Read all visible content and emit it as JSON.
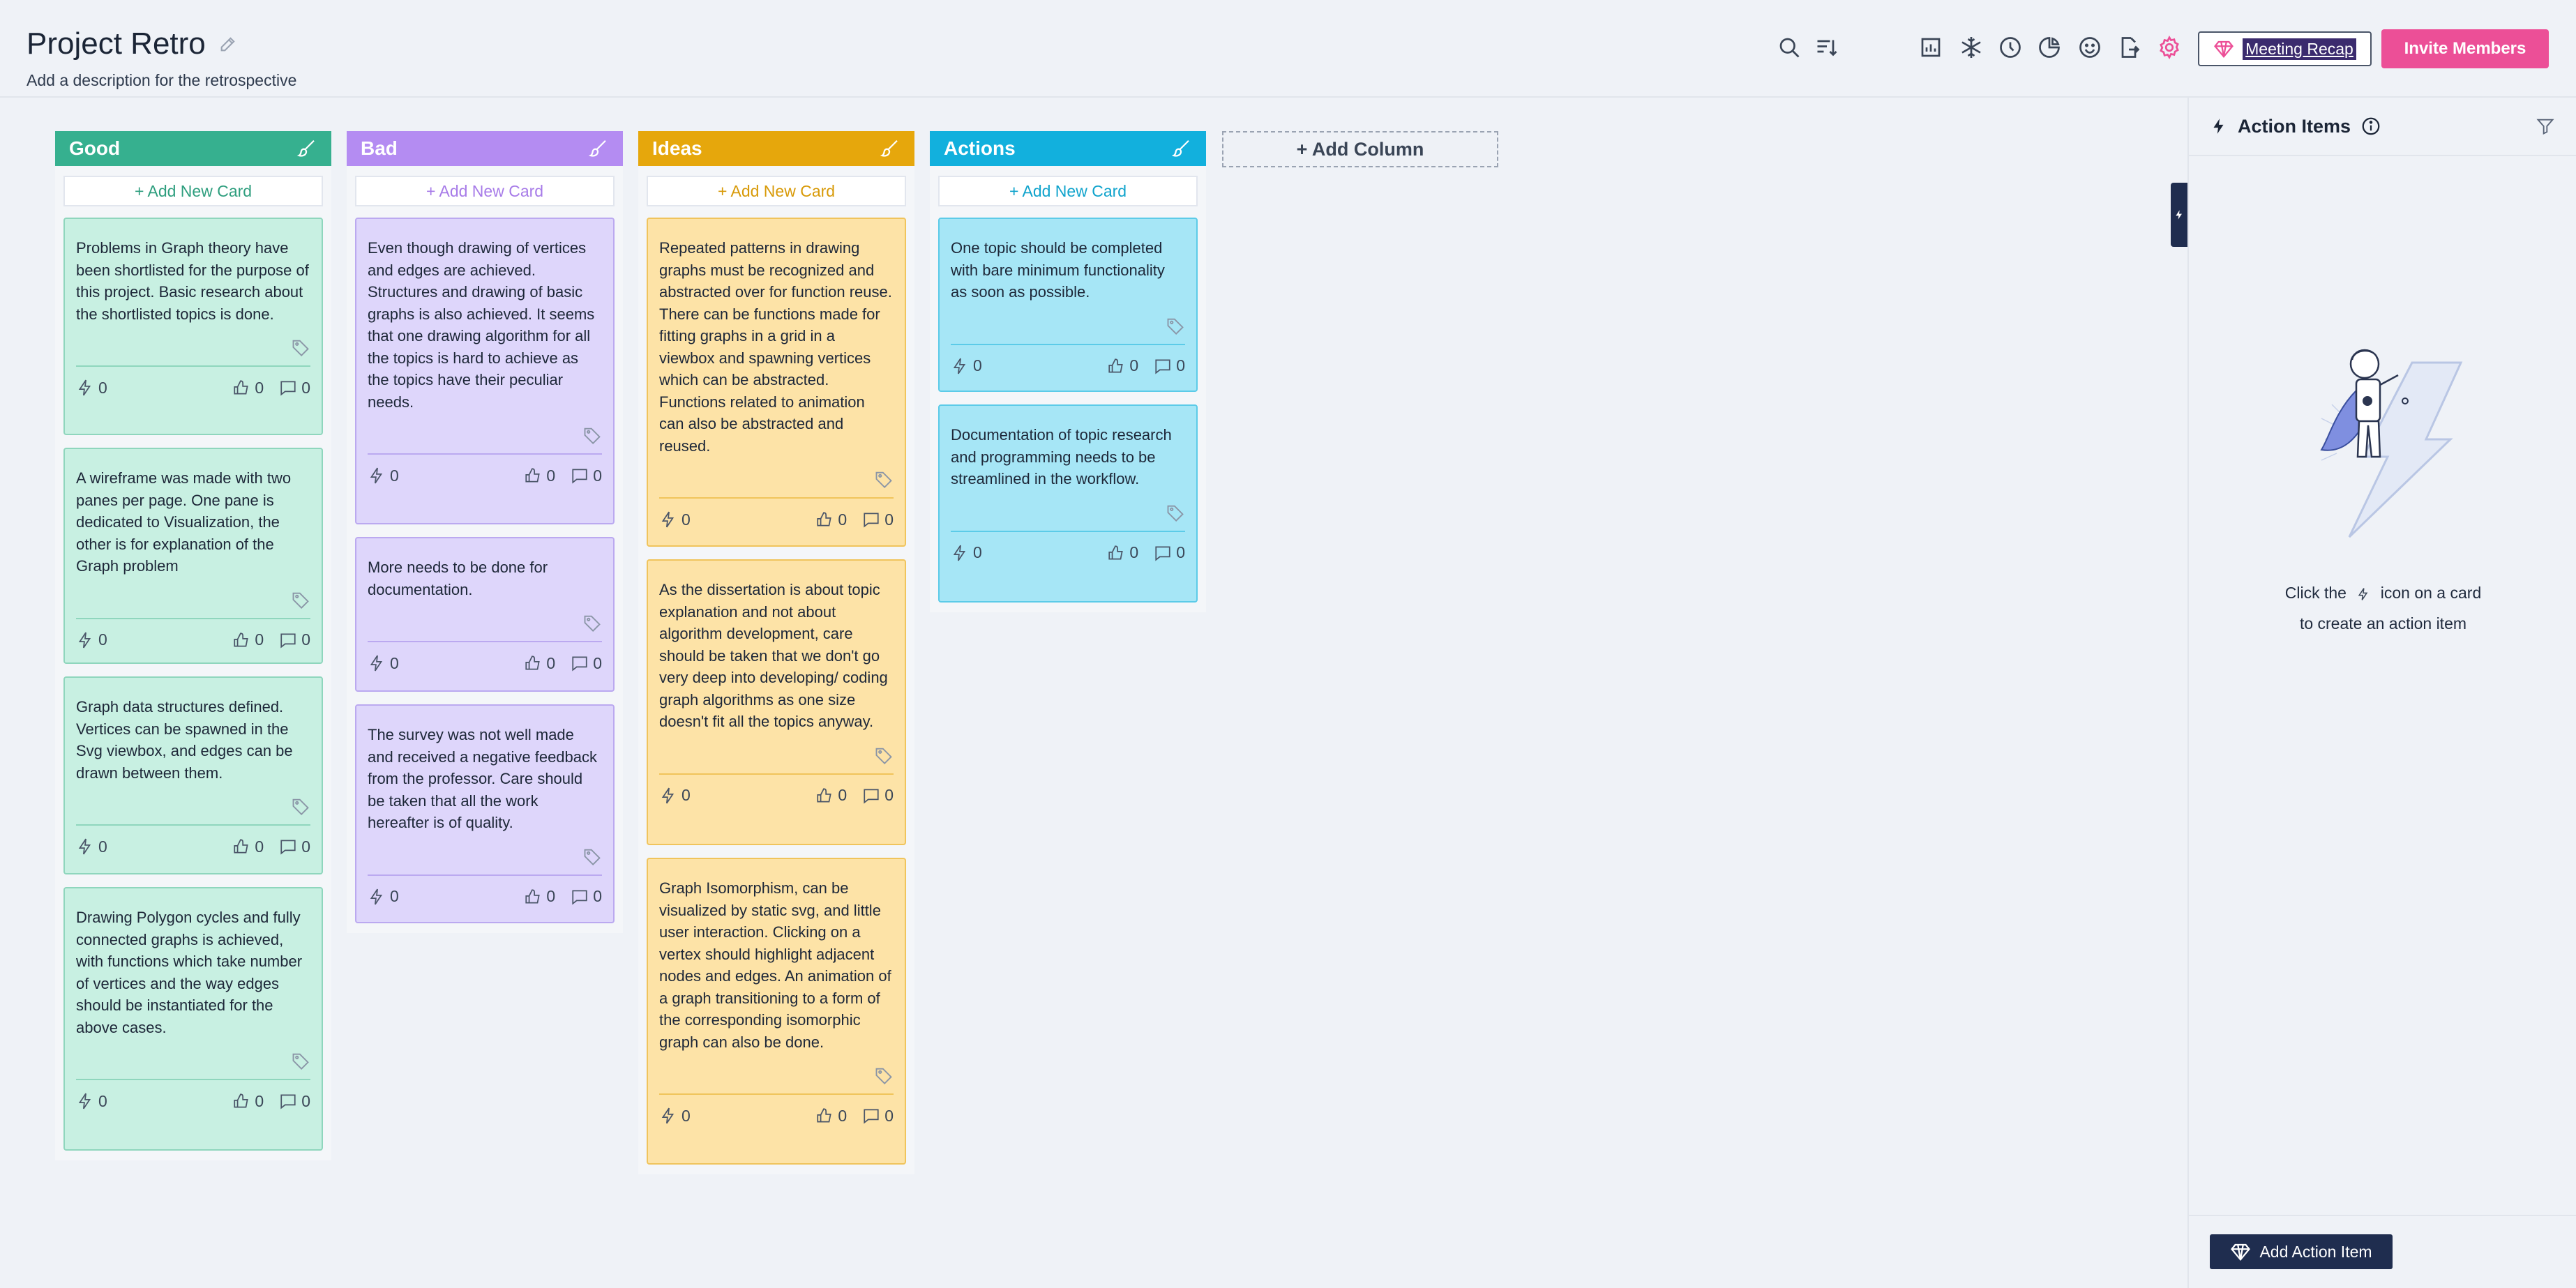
{
  "header": {
    "title": "Project Retro",
    "description": "Add a description for the retrospective",
    "meeting_recap_label": "Meeting Recap",
    "invite_label": "Invite Members"
  },
  "board": {
    "add_column_label": "+ Add Column",
    "columns": [
      {
        "name": "Good",
        "add_label": "+ Add New Card",
        "color": "#36b08f",
        "cards": [
          {
            "text": "Problems in Graph theory have been shortlisted for the purpose of this project. Basic research about the shortlisted topics is done.",
            "actions": "0",
            "votes": "0",
            "comments": "0"
          },
          {
            "text": "A wireframe was made with two panes per page. One pane is dedicated to Visualization, the other is for explanation of the Graph problem",
            "actions": "0",
            "votes": "0",
            "comments": "0"
          },
          {
            "text": "Graph data structures defined. Vertices can be spawned in the Svg viewbox, and edges can be drawn between them.",
            "actions": "0",
            "votes": "0",
            "comments": "0"
          },
          {
            "text": "Drawing Polygon cycles and fully connected graphs is achieved, with functions which take number of vertices and the way edges should be instantiated for the above cases.",
            "actions": "0",
            "votes": "0",
            "comments": "0"
          }
        ]
      },
      {
        "name": "Bad",
        "add_label": "+ Add New Card",
        "color": "#b48cf2",
        "cards": [
          {
            "text": "Even though drawing of vertices and edges are achieved. Structures and drawing of basic graphs is also achieved. It seems that one drawing algorithm for all the topics is hard to achieve as the topics have their peculiar needs.",
            "actions": "0",
            "votes": "0",
            "comments": "0"
          },
          {
            "text": "More needs to be done for documentation.",
            "actions": "0",
            "votes": "0",
            "comments": "0"
          },
          {
            "text": "The survey was not well made and received a negative feedback from the professor. Care should be taken that all the work hereafter is of quality.",
            "actions": "0",
            "votes": "0",
            "comments": "0"
          }
        ]
      },
      {
        "name": "Ideas",
        "add_label": "+ Add New Card",
        "color": "#e6a70c",
        "cards": [
          {
            "text": "Repeated patterns in drawing graphs must be recognized and abstracted over for function reuse. There can be functions made for fitting graphs in a grid in a viewbox and spawning vertices which can be abstracted. Functions related to animation can also be abstracted and reused.",
            "actions": "0",
            "votes": "0",
            "comments": "0"
          },
          {
            "text": "As the dissertation is about topic explanation and not about algorithm development, care should be taken that we don't go very deep into developing/ coding graph algorithms as one size doesn't fit all the topics anyway.",
            "actions": "0",
            "votes": "0",
            "comments": "0"
          },
          {
            "text": "Graph Isomorphism, can be visualized by static svg, and little user interaction. Clicking on a vertex should highlight adjacent nodes and edges. An animation of a graph transitioning to a form of the corresponding isomorphic graph can also be done.",
            "actions": "0",
            "votes": "0",
            "comments": "0"
          }
        ]
      },
      {
        "name": "Actions",
        "add_label": "+ Add New Card",
        "color": "#12b0dd",
        "cards": [
          {
            "text": "One topic should be completed with bare minimum functionality as soon as possible.",
            "actions": "0",
            "votes": "0",
            "comments": "0"
          },
          {
            "text": "Documentation of topic research and programming needs to be streamlined in the workflow.",
            "actions": "0",
            "votes": "0",
            "comments": "0"
          }
        ]
      }
    ]
  },
  "panel": {
    "title": "Action Items",
    "hint_before": "Click the",
    "hint_after": "icon on a card",
    "hint_line2": "to create an action item",
    "add_action_label": "Add Action Item"
  }
}
